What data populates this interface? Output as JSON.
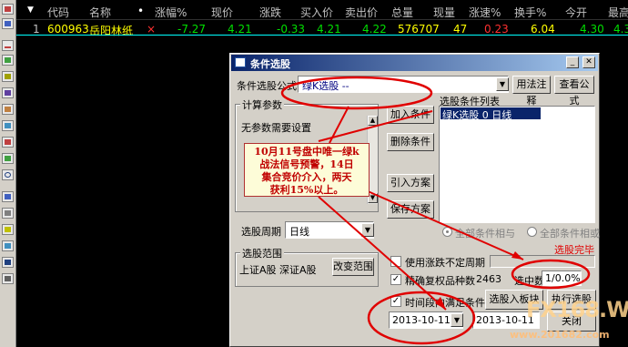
{
  "grid": {
    "headers": [
      "代码",
      "名称",
      "•",
      "涨幅%",
      "现价",
      "涨跌",
      "买入价",
      "卖出价",
      "总量",
      "现量",
      "涨速%",
      "换手%",
      "今开",
      "最高"
    ],
    "row": {
      "index": "1",
      "code": "600963",
      "name": "岳阳林纸",
      "flag": "×",
      "change_pct": "-7.27",
      "price": "4.21",
      "change": "-0.33",
      "bid": "4.21",
      "ask": "4.22",
      "volume": "576707",
      "cur_volume": "47",
      "speed": "0.23",
      "turnover": "6.04",
      "open": "4.30",
      "high": "4.30"
    }
  },
  "dialog": {
    "title": "条件选股",
    "formula_label": "条件选股公式",
    "formula_value": "绿K选股  --",
    "btn_usage": "用法注释",
    "btn_view_formula": "查看公式",
    "calc_params_group": "计算参数",
    "no_params_text": "无参数需要设置",
    "btn_add": "加入条件",
    "btn_delete": "删除条件",
    "btn_import": "引入方案",
    "btn_save": "保存方案",
    "list_header": "选股条件列表",
    "list_item": "绿K选股  0  日线",
    "radio_all_and": "全部条件相与",
    "radio_all_or": "全部条件相或",
    "period_label": "选股周期",
    "period_value": "日线",
    "range_group": "选股范围",
    "range_value": "上证A股  深证A股",
    "btn_change_range": "改变范围",
    "status_done": "选股完毕",
    "chk_uncertain": "使用涨跌不定周期",
    "chk_exclude": "精确复权",
    "count_label": "品种数",
    "count_value": "2463",
    "selected_label": "选中数",
    "selected_value": "1/0.0%",
    "chk_time": "时间段内满足条件",
    "date_from": "2013-10-11",
    "date_to": "2013-10-11",
    "btn_into_board": "选股入板块",
    "btn_run": "执行选股",
    "btn_close": "关闭"
  },
  "annotation": {
    "line1": "10月11号盘中唯一绿k",
    "line2": "战法信号预警，14日",
    "line3": "集合竞价介入，两天",
    "line4": "获利15%以上。"
  },
  "watermark": {
    "brand": "FX168.W",
    "url": "www.201682.com"
  },
  "colors": {
    "down_green": "#00e000",
    "up_red": "#ff3030",
    "yellow": "#ffff00",
    "arrow_red": "#e00000",
    "selection_blue": "#0a246a"
  }
}
